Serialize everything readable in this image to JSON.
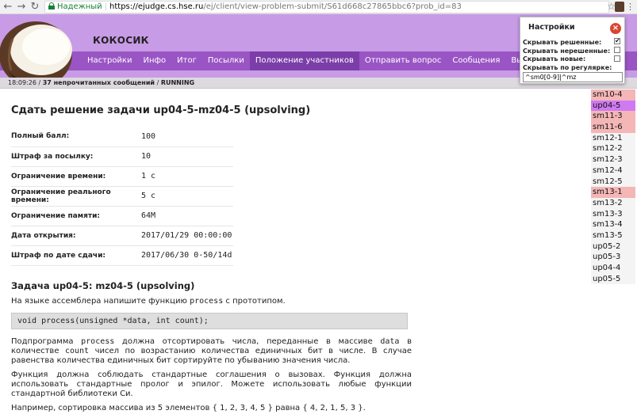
{
  "browser": {
    "secure_label": "Надежный",
    "url_host": "https://ejudge.cs.hse.ru",
    "url_path": "/ej/client/view-problem-submit/S61d668c27865bbc6?prob_id=83"
  },
  "site": {
    "title": "КОКОСИК",
    "menu": [
      "Настройки",
      "Инфо",
      "Итог",
      "Посылки",
      "Положение участников",
      "Отправить вопрос",
      "Сообщения",
      "Выйти из системы"
    ],
    "active_menu": "Положение участников"
  },
  "status": {
    "time": "18:09:26",
    "messages": "37 непрочитанных сообщений",
    "state": "RUNNING"
  },
  "problem": {
    "heading": "Сдать решение задачи up04-5-mz04-5 (upsolving)",
    "info": [
      {
        "key": "Полный балл:",
        "value": "100"
      },
      {
        "key": "Штраф за посылку:",
        "value": "10"
      },
      {
        "key": "Ограничение времени:",
        "value": "1 с"
      },
      {
        "key": "Ограничение реального времени:",
        "value": "5 с"
      },
      {
        "key": "Ограничение памяти:",
        "value": "64M"
      },
      {
        "key": "Дата открытия:",
        "value": "2017/01/29 00:00:00"
      },
      {
        "key": "Штраф по дате сдачи:",
        "value": "2017/06/30 0-50/14d"
      }
    ],
    "task_heading": "Задача up04-5: mz04-5 (upsolving)",
    "p1_before": "На языке ассемблера напишите функцию ",
    "p1_code": "process",
    "p1_after": " с прототипом.",
    "prototype": "void process(unsigned *data, int count);",
    "p2_a": "Подпрограмма ",
    "p2_code1": "process",
    "p2_b": " должна отсортировать числа, переданные в массиве ",
    "p2_code2": "data",
    "p2_c": " в количестве ",
    "p2_code3": "count",
    "p2_d": " чисел по возрастанию количества единичных бит в числе. В случае равенства количества единичных бит сортируйте по убыванию значения числа.",
    "p3": "Функция должна соблюдать стандартные соглашения о вызовах. Функция должна использовать стандартные пролог и эпилог. Можете использовать любые функции стандартной библиотеки Си.",
    "p4": "Например, сортировка массива из 5 элементов { 1, 2, 3, 4, 5 } равна { 4, 2, 1, 5, 3 }."
  },
  "problem_list": [
    {
      "name": "sm10-4",
      "status": "red"
    },
    {
      "name": "up04-5",
      "status": "current"
    },
    {
      "name": "sm11-3",
      "status": "red"
    },
    {
      "name": "sm11-6",
      "status": "red"
    },
    {
      "name": "sm12-1",
      "status": "none"
    },
    {
      "name": "sm12-2",
      "status": "none"
    },
    {
      "name": "sm12-3",
      "status": "none"
    },
    {
      "name": "sm12-4",
      "status": "none"
    },
    {
      "name": "sm12-5",
      "status": "none"
    },
    {
      "name": "sm13-1",
      "status": "red"
    },
    {
      "name": "sm13-2",
      "status": "none"
    },
    {
      "name": "sm13-3",
      "status": "none"
    },
    {
      "name": "sm13-4",
      "status": "none"
    },
    {
      "name": "sm13-5",
      "status": "none"
    },
    {
      "name": "up05-2",
      "status": "none"
    },
    {
      "name": "up05-3",
      "status": "none"
    },
    {
      "name": "up04-4",
      "status": "none"
    },
    {
      "name": "up05-5",
      "status": "none"
    }
  ],
  "settings_popup": {
    "title": "Настройки",
    "hide_solved_label": "Скрывать решенные:",
    "hide_solved": true,
    "hide_unsolved_label": "Скрывать нерешенные:",
    "hide_unsolved": false,
    "hide_new_label": "Скрывать новые:",
    "hide_new": false,
    "hide_regex_label": "Скрывать по регулярке:",
    "hide_regex_value": "^sm0[0-9]|^mz"
  },
  "colors": {
    "header_bg": "#c89be6",
    "menu_bg": "#9a55c5",
    "menu_active": "#7b3ea8",
    "problem_red": "#f4b6b6",
    "problem_current": "#cf7af2"
  }
}
